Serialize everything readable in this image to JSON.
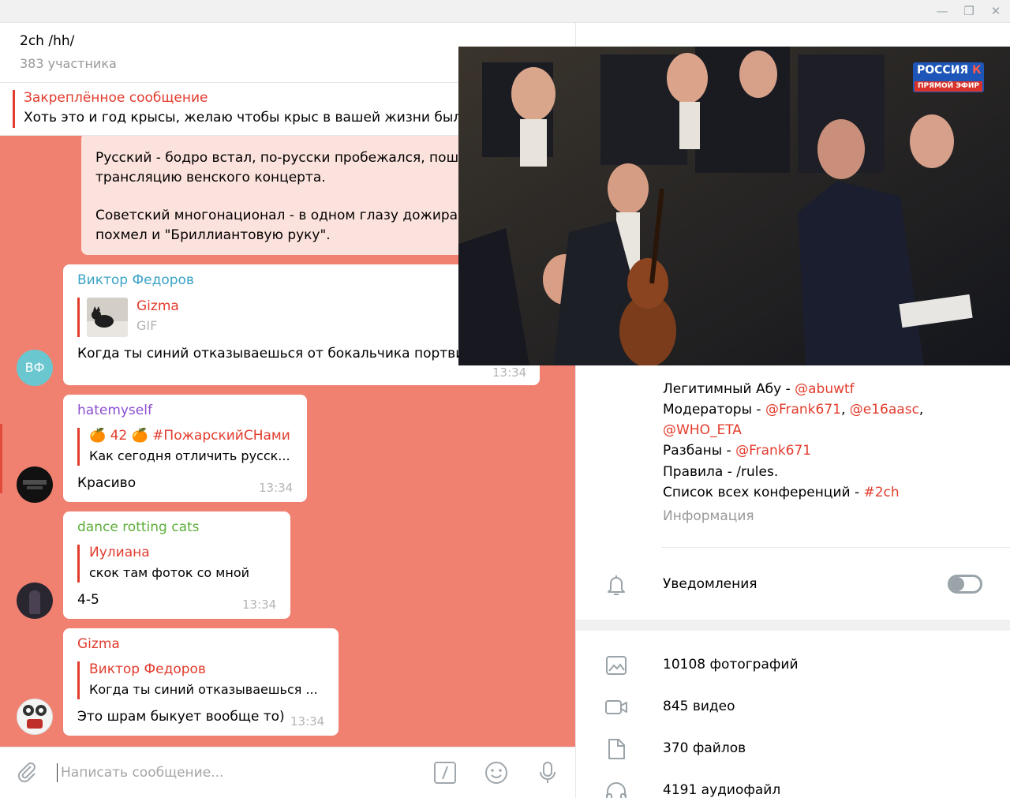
{
  "chat": {
    "title": "2ch /hh/",
    "subtitle": "383 участника",
    "pinned": {
      "title": "Закреплённое сообщение",
      "text": "Хоть это и год крысы, желаю чтобы крыс в вашей жизни было"
    }
  },
  "messages": {
    "m1": {
      "line1": "Русский - бодро встал, по-русски пробежался, пошёл",
      "line2": "трансляцию венского концерта.",
      "line3": "Советский многонационал - в одном глазу дожирает",
      "line4": "похмел и \"Бриллиантовую руку\"."
    },
    "m2": {
      "sender": "Виктор Федоров",
      "avatar_initials": "ВФ",
      "gif_name": "Gizma",
      "gif_type": "GIF",
      "text": "Когда ты синий отказываешься от бокальчика портвиш",
      "time": "13:34"
    },
    "m3": {
      "sender": "hatemyself",
      "reply_name": "🍊 42 🍊 #ПожарскийСНами",
      "reply_text": "Как сегодня отличить русск...",
      "text": "Красиво",
      "time": "13:34"
    },
    "m4": {
      "sender": "dance rotting cats",
      "reply_name": "Иулиана",
      "reply_text": "скок там фоток со мной",
      "text": "4-5",
      "time": "13:34"
    },
    "m5": {
      "sender": "Gizma",
      "reply_name": "Виктор Федоров",
      "reply_text": "Когда ты синий отказываешься ...",
      "text": "Это шрам быкует вообще то)",
      "time": "13:34"
    }
  },
  "composer": {
    "placeholder": "Написать сообщение..."
  },
  "info": {
    "admin_label": "Легитимный Абу - ",
    "admin_link": "@abuwtf",
    "mods_label": "Модераторы - ",
    "mods_link1": "@Frank671",
    "mods_sep": ", ",
    "mods_link2": "@e16aasc",
    "mods_tail": ",",
    "mods_link3": "@WHO_ETA",
    "unban_label": "Разбаны - ",
    "unban_link": "@Frank671",
    "rules_text": "Правила - /rules.",
    "list_label": "Список всех конференций - ",
    "list_link": "#2ch",
    "caption": "Информация"
  },
  "settings": {
    "notifications_label": "Уведомления",
    "notifications_on": false
  },
  "media": {
    "photos": "10108 фотографий",
    "videos": "845 видео",
    "files": "370 файлов",
    "audio": "4191 аудиофайл"
  },
  "video_overlay": {
    "channel": "РОССИЯ",
    "channel_mark": "К",
    "live": "ПРЯМОЙ ЭФИР"
  },
  "colors": {
    "accent": "#e23c2d",
    "chat_background": "#f08070",
    "outgoing_bubble": "#fce2dd",
    "sender_vf": "#3aa3c6",
    "sender_hatemyself": "#8a4fd0",
    "sender_dance": "#5cae3a"
  }
}
